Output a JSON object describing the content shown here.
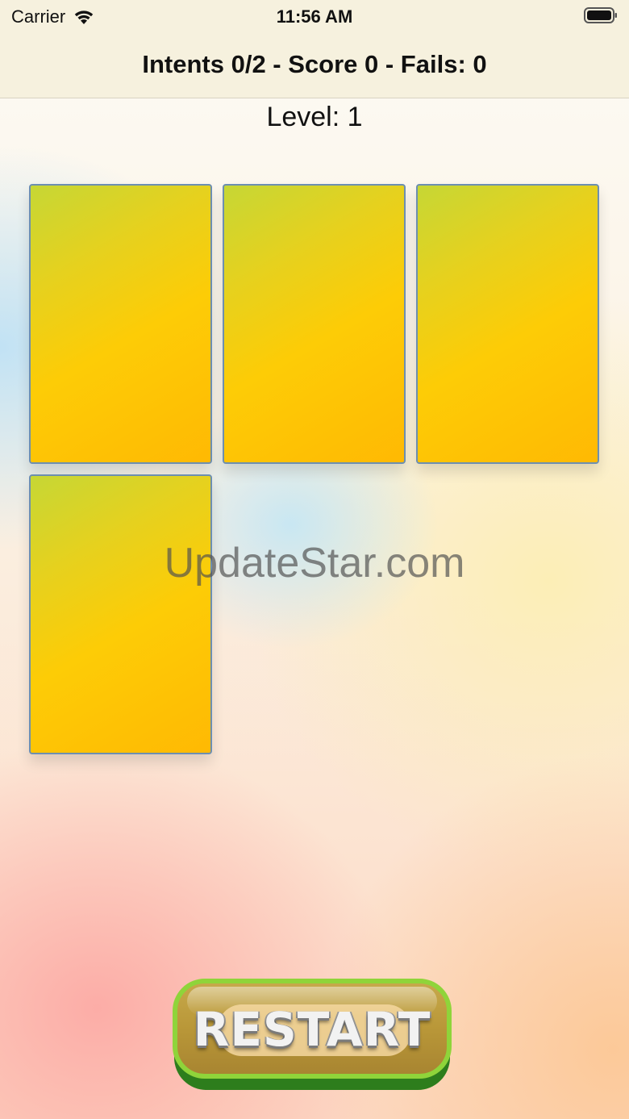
{
  "status_bar": {
    "carrier": "Carrier",
    "time": "11:56 AM",
    "wifi_icon": "wifi-icon",
    "battery_icon": "battery-icon"
  },
  "nav": {
    "title": "Intents 0/2 - Score 0 - Fails: 0"
  },
  "game": {
    "level_label": "Level: 1",
    "cards": [
      {
        "state": "face-down"
      },
      {
        "state": "face-down"
      },
      {
        "state": "face-down"
      },
      {
        "state": "face-down"
      }
    ],
    "card_colors": {
      "gradient_start": "#c6d735",
      "gradient_end": "#ffb903",
      "border": "#6d8fb0"
    }
  },
  "watermark": "UpdateStar.com",
  "restart_button": {
    "label": "RESTART",
    "rim_color": "#8fd43a",
    "base_color": "#2d7d1c"
  }
}
